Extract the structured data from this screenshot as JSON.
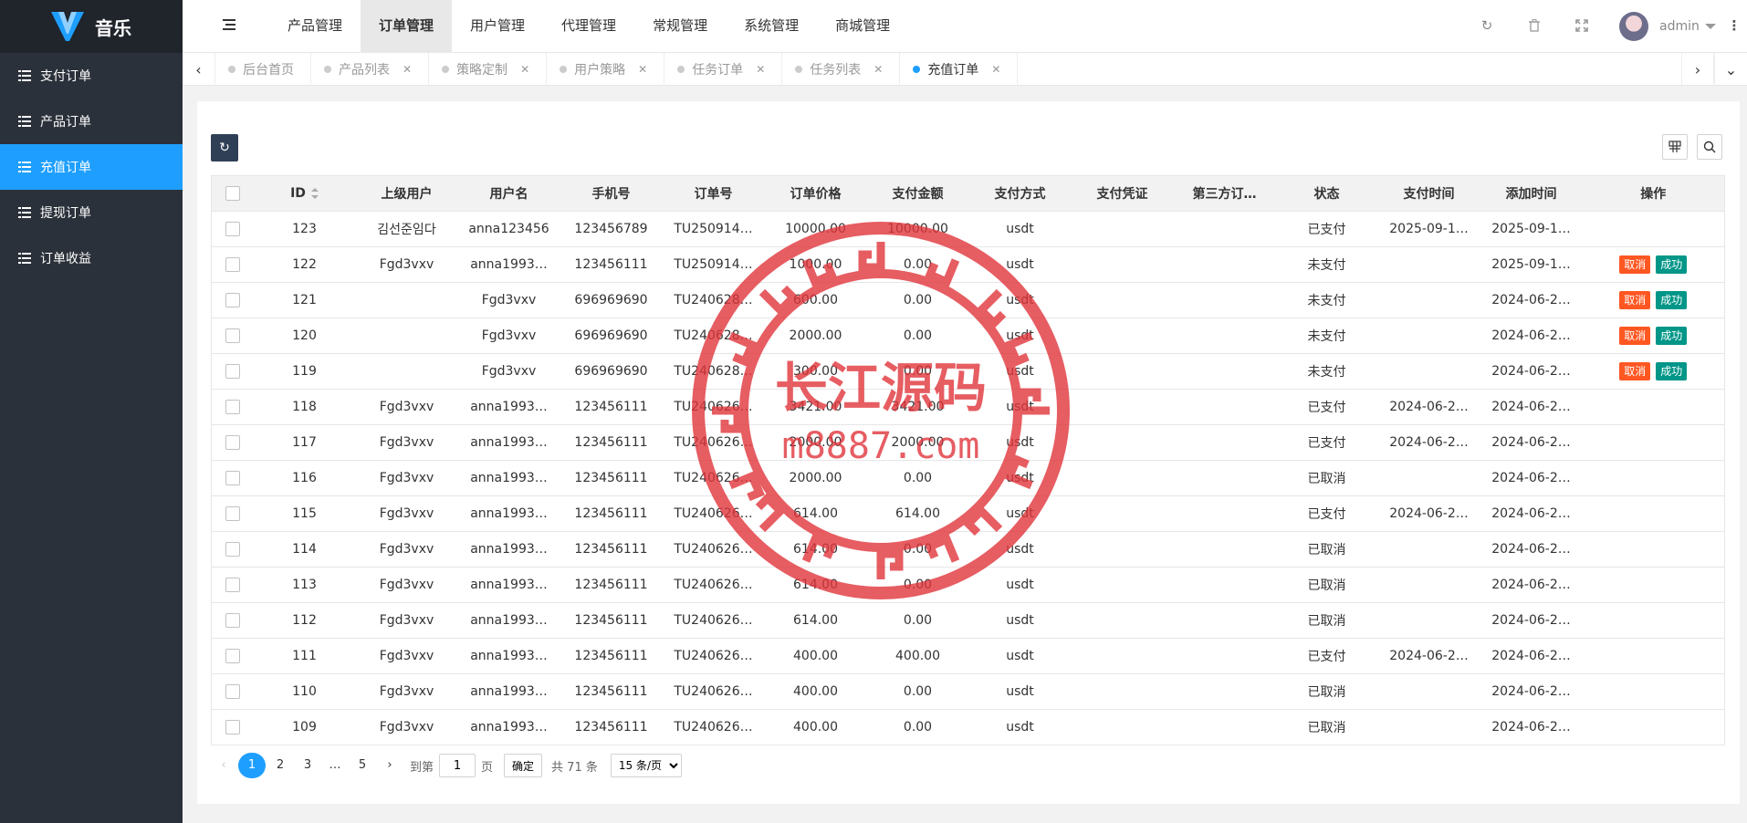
{
  "app": {
    "title": "音乐"
  },
  "sidebar": {
    "items": [
      {
        "label": "支付订单",
        "active": false
      },
      {
        "label": "产品订单",
        "active": false
      },
      {
        "label": "充值订单",
        "active": true
      },
      {
        "label": "提现订单",
        "active": false
      },
      {
        "label": "订单收益",
        "active": false
      }
    ]
  },
  "header": {
    "nav": [
      "产品管理",
      "订单管理",
      "用户管理",
      "代理管理",
      "常规管理",
      "系统管理",
      "商城管理"
    ],
    "active_nav": "订单管理",
    "user": "admin"
  },
  "tabs": [
    {
      "label": "后台首页",
      "closable": false,
      "active": false
    },
    {
      "label": "产品列表",
      "closable": true,
      "active": false
    },
    {
      "label": "策略定制",
      "closable": true,
      "active": false
    },
    {
      "label": "用户策略",
      "closable": true,
      "active": false
    },
    {
      "label": "任务订单",
      "closable": true,
      "active": false
    },
    {
      "label": "任务列表",
      "closable": true,
      "active": false
    },
    {
      "label": "充值订单",
      "closable": true,
      "active": true
    }
  ],
  "table": {
    "columns": [
      "ID",
      "上级用户",
      "用户名",
      "手机号",
      "订单号",
      "订单价格",
      "支付金额",
      "支付方式",
      "支付凭证",
      "第三方订…",
      "状态",
      "支付时间",
      "添加时间",
      "操作"
    ],
    "rows": [
      {
        "id": "123",
        "parent": "김선준임다",
        "user": "anna123456",
        "phone": "123456789",
        "order": "TU250914…",
        "price": "10000.00",
        "paid": "10000.00",
        "method": "usdt",
        "proof": "",
        "third": "",
        "status": "已支付",
        "pay_time": "2025-09-1…",
        "add_time": "2025-09-1…",
        "actions": false
      },
      {
        "id": "122",
        "parent": "Fgd3vxv",
        "user": "anna1993…",
        "phone": "123456111",
        "order": "TU250914…",
        "price": "1000.00",
        "paid": "0.00",
        "method": "usdt",
        "proof": "",
        "third": "",
        "status": "未支付",
        "pay_time": "",
        "add_time": "2025-09-1…",
        "actions": true
      },
      {
        "id": "121",
        "parent": "",
        "user": "Fgd3vxv",
        "phone": "696969690",
        "order": "TU240628…",
        "price": "600.00",
        "paid": "0.00",
        "method": "usdt",
        "proof": "",
        "third": "",
        "status": "未支付",
        "pay_time": "",
        "add_time": "2024-06-2…",
        "actions": true
      },
      {
        "id": "120",
        "parent": "",
        "user": "Fgd3vxv",
        "phone": "696969690",
        "order": "TU240628…",
        "price": "2000.00",
        "paid": "0.00",
        "method": "usdt",
        "proof": "",
        "third": "",
        "status": "未支付",
        "pay_time": "",
        "add_time": "2024-06-2…",
        "actions": true
      },
      {
        "id": "119",
        "parent": "",
        "user": "Fgd3vxv",
        "phone": "696969690",
        "order": "TU240628…",
        "price": "300.00",
        "paid": "0.00",
        "method": "usdt",
        "proof": "",
        "third": "",
        "status": "未支付",
        "pay_time": "",
        "add_time": "2024-06-2…",
        "actions": true
      },
      {
        "id": "118",
        "parent": "Fgd3vxv",
        "user": "anna1993…",
        "phone": "123456111",
        "order": "TU240626…",
        "price": "3421.00",
        "paid": "3421.00",
        "method": "usdt",
        "proof": "",
        "third": "",
        "status": "已支付",
        "pay_time": "2024-06-2…",
        "add_time": "2024-06-2…",
        "actions": false
      },
      {
        "id": "117",
        "parent": "Fgd3vxv",
        "user": "anna1993…",
        "phone": "123456111",
        "order": "TU240626…",
        "price": "2000.00",
        "paid": "2000.00",
        "method": "usdt",
        "proof": "",
        "third": "",
        "status": "已支付",
        "pay_time": "2024-06-2…",
        "add_time": "2024-06-2…",
        "actions": false
      },
      {
        "id": "116",
        "parent": "Fgd3vxv",
        "user": "anna1993…",
        "phone": "123456111",
        "order": "TU240626…",
        "price": "2000.00",
        "paid": "0.00",
        "method": "usdt",
        "proof": "",
        "third": "",
        "status": "已取消",
        "pay_time": "",
        "add_time": "2024-06-2…",
        "actions": false
      },
      {
        "id": "115",
        "parent": "Fgd3vxv",
        "user": "anna1993…",
        "phone": "123456111",
        "order": "TU240626…",
        "price": "614.00",
        "paid": "614.00",
        "method": "usdt",
        "proof": "",
        "third": "",
        "status": "已支付",
        "pay_time": "2024-06-2…",
        "add_time": "2024-06-2…",
        "actions": false
      },
      {
        "id": "114",
        "parent": "Fgd3vxv",
        "user": "anna1993…",
        "phone": "123456111",
        "order": "TU240626…",
        "price": "614.00",
        "paid": "0.00",
        "method": "usdt",
        "proof": "",
        "third": "",
        "status": "已取消",
        "pay_time": "",
        "add_time": "2024-06-2…",
        "actions": false
      },
      {
        "id": "113",
        "parent": "Fgd3vxv",
        "user": "anna1993…",
        "phone": "123456111",
        "order": "TU240626…",
        "price": "614.00",
        "paid": "0.00",
        "method": "usdt",
        "proof": "",
        "third": "",
        "status": "已取消",
        "pay_time": "",
        "add_time": "2024-06-2…",
        "actions": false
      },
      {
        "id": "112",
        "parent": "Fgd3vxv",
        "user": "anna1993…",
        "phone": "123456111",
        "order": "TU240626…",
        "price": "614.00",
        "paid": "0.00",
        "method": "usdt",
        "proof": "",
        "third": "",
        "status": "已取消",
        "pay_time": "",
        "add_time": "2024-06-2…",
        "actions": false
      },
      {
        "id": "111",
        "parent": "Fgd3vxv",
        "user": "anna1993…",
        "phone": "123456111",
        "order": "TU240626…",
        "price": "400.00",
        "paid": "400.00",
        "method": "usdt",
        "proof": "",
        "third": "",
        "status": "已支付",
        "pay_time": "2024-06-2…",
        "add_time": "2024-06-2…",
        "actions": false
      },
      {
        "id": "110",
        "parent": "Fgd3vxv",
        "user": "anna1993…",
        "phone": "123456111",
        "order": "TU240626…",
        "price": "400.00",
        "paid": "0.00",
        "method": "usdt",
        "proof": "",
        "third": "",
        "status": "已取消",
        "pay_time": "",
        "add_time": "2024-06-2…",
        "actions": false
      },
      {
        "id": "109",
        "parent": "Fgd3vxv",
        "user": "anna1993…",
        "phone": "123456111",
        "order": "TU240626…",
        "price": "400.00",
        "paid": "0.00",
        "method": "usdt",
        "proof": "",
        "third": "",
        "status": "已取消",
        "pay_time": "",
        "add_time": "2024-06-2…",
        "actions": false
      }
    ],
    "cancel_label": "取消",
    "success_label": "成功"
  },
  "pager": {
    "pages": [
      "1",
      "2",
      "3",
      "…",
      "5"
    ],
    "current": "1",
    "goto_prefix": "到第",
    "goto_value": "1",
    "goto_suffix": "页",
    "confirm": "确定",
    "total": "共 71 条",
    "per_page": "15 条/页"
  },
  "watermark": {
    "line1": "长江源码",
    "line2": "m8887.com"
  },
  "colors": {
    "sidebar": "#2b313a",
    "accent": "#1e9fff",
    "cancel": "#ff5722",
    "success": "#009688"
  }
}
